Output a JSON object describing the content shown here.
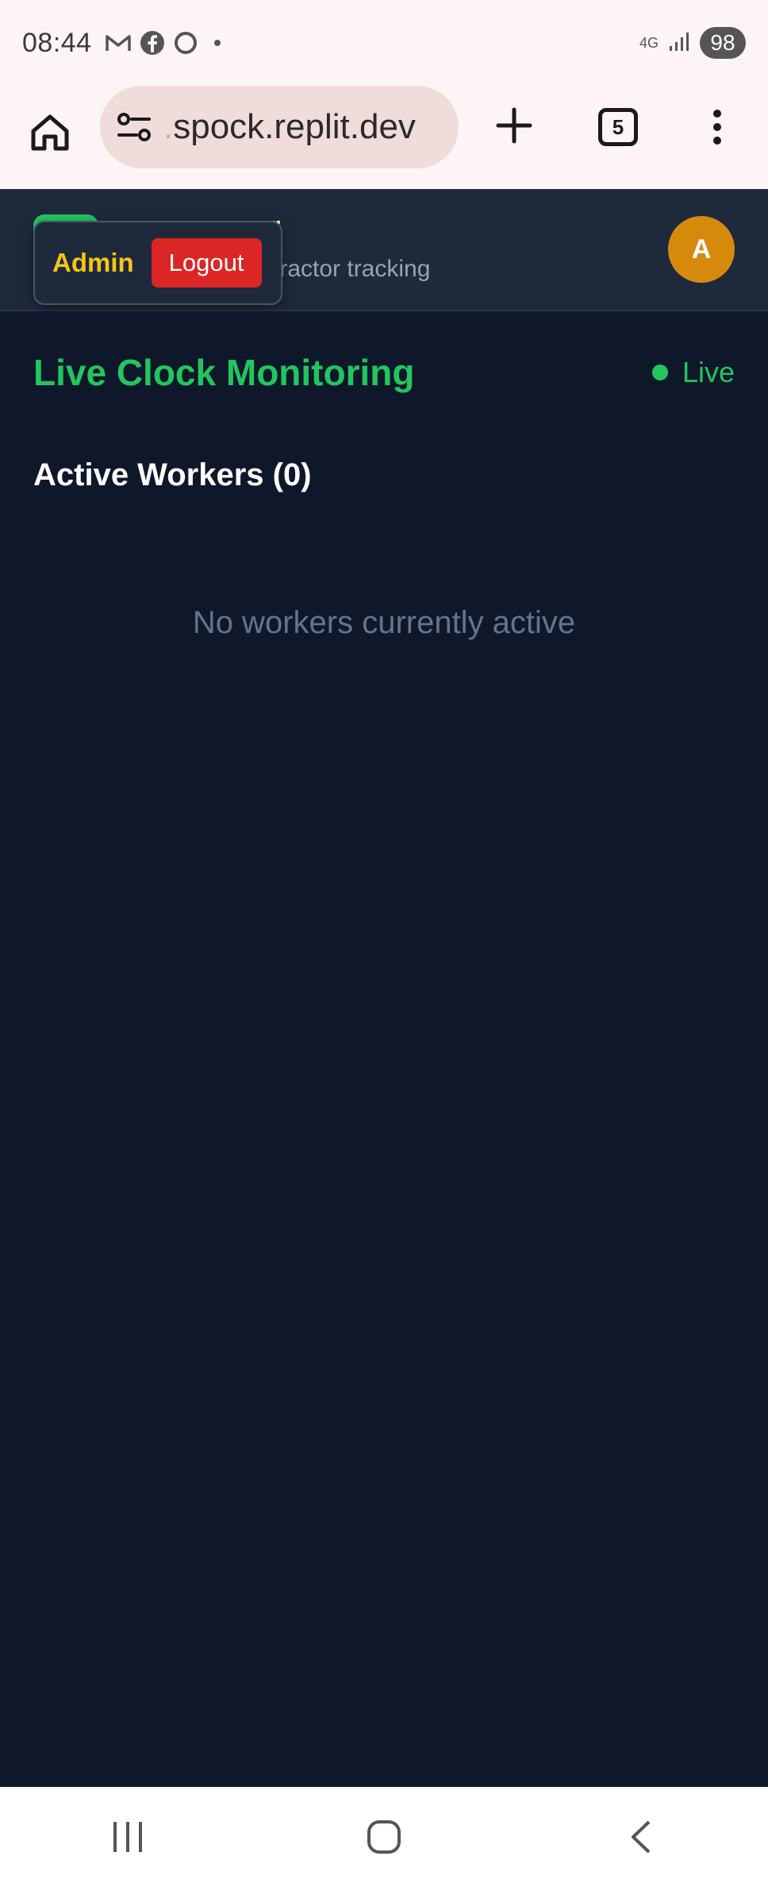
{
  "status_bar": {
    "time": "08:44",
    "notification_icons": [
      "gmail-icon",
      "facebook-icon",
      "circle-app-icon"
    ],
    "network_label": "4G",
    "battery": "98"
  },
  "browser": {
    "url_faded_prefix": ".",
    "url": "spock.replit.dev",
    "tab_count": "5"
  },
  "header": {
    "title_fragment": "r",
    "subtitle_fragment": "tractor tracking",
    "avatar_initial": "A"
  },
  "user_menu": {
    "role": "Admin",
    "logout_label": "Logout"
  },
  "main": {
    "title": "Live Clock Monitoring",
    "live_label": "Live",
    "section_heading": "Active Workers (0)",
    "empty_state": "No workers currently active"
  },
  "colors": {
    "accent_green": "#22c55e",
    "background": "#0f172a",
    "header_bg": "#1e293b",
    "admin_yellow": "#f5c518",
    "logout_red": "#dc2626",
    "avatar_orange": "#d68a0c"
  }
}
